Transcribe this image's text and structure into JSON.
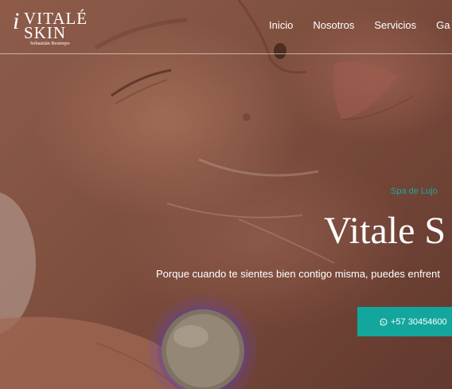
{
  "brand": {
    "logo_mark": "i",
    "line1": "VITALÉ",
    "line2": "SKIN",
    "subtitle": "Sebastián Restrepo"
  },
  "nav": {
    "items": [
      "Inicio",
      "Nosotros",
      "Servicios",
      "Ga"
    ]
  },
  "hero": {
    "eyebrow": "Spa de Lujo",
    "title": "Vitale S",
    "subtitle": "Porque cuando te sientes bien contigo misma, puedes enfrent",
    "cta_label": "+57 30454600",
    "cta_icon": "whatsapp-icon"
  },
  "colors": {
    "accent": "#13a69c",
    "eyebrow": "#1fa59c",
    "text": "#ffffff"
  }
}
